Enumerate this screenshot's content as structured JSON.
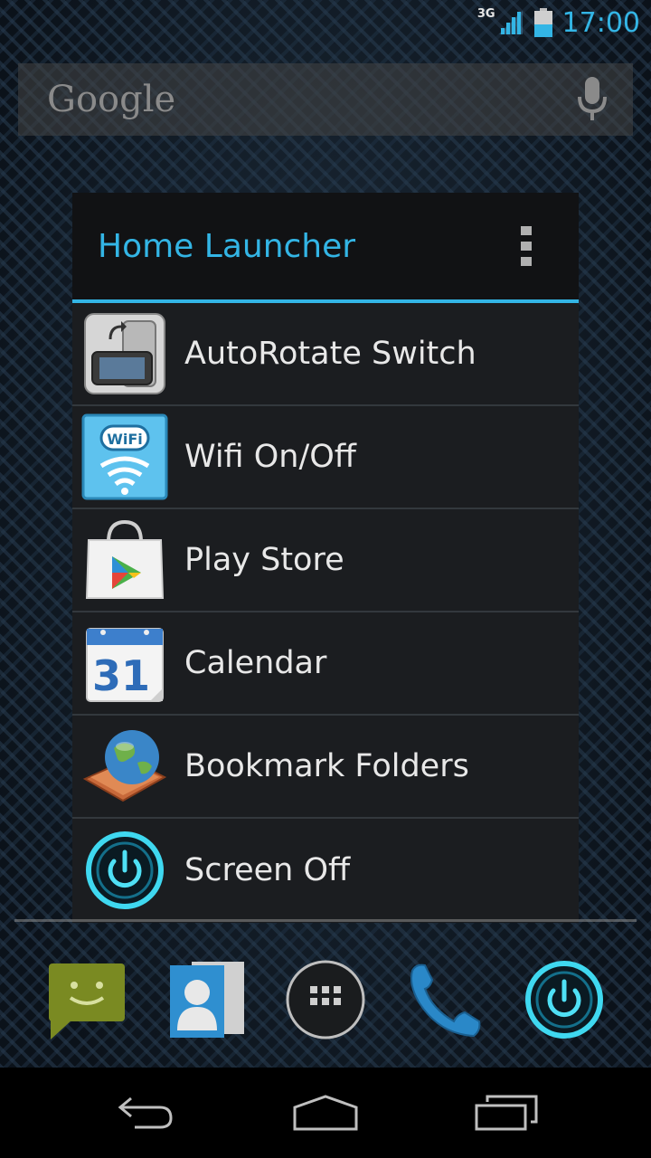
{
  "status_bar": {
    "network_type": "3G",
    "clock": "17:00",
    "icons": [
      "signal-icon",
      "battery-icon"
    ]
  },
  "search": {
    "logo_text": "Google",
    "icons": [
      "mic-icon"
    ]
  },
  "dialog": {
    "title": "Home Launcher",
    "menu_icon": "overflow-menu-icon",
    "accent_color": "#33b5e5",
    "items": [
      {
        "label": "AutoRotate Switch",
        "icon": "autorotate-icon"
      },
      {
        "label": "Wifi On/Off",
        "icon": "wifi-icon",
        "icon_text": "WiFi"
      },
      {
        "label": "Play Store",
        "icon": "play-store-icon"
      },
      {
        "label": "Calendar",
        "icon": "calendar-icon",
        "icon_text": "31"
      },
      {
        "label": "Bookmark Folders",
        "icon": "bookmark-folders-icon"
      },
      {
        "label": "Screen Off",
        "icon": "screen-off-icon"
      }
    ]
  },
  "dock": {
    "items": [
      "messaging-icon",
      "contacts-icon",
      "app-drawer-icon",
      "phone-icon",
      "screen-off-icon"
    ]
  },
  "nav_bar": {
    "buttons": [
      "back-icon",
      "home-icon",
      "recent-apps-icon"
    ]
  }
}
